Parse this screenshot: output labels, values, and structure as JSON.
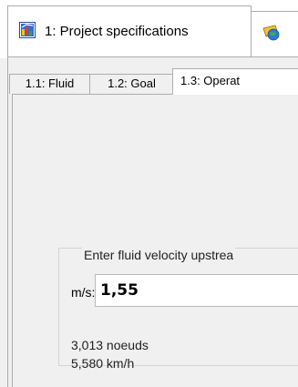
{
  "outer_tabs": [
    {
      "label": "1: Project specifications",
      "icon": "project-chart-icon",
      "active": true
    },
    {
      "label": "",
      "icon": "project-globe-icon",
      "active": false
    }
  ],
  "inner_tabs": [
    {
      "label": "1.1: Fluid"
    },
    {
      "label": "1.2: Goal"
    },
    {
      "label": "1.3: Operat",
      "active": true
    }
  ],
  "velocity": {
    "group_title": "Enter fluid velocity  upstrea",
    "unit": "m/s:",
    "value": "1,55",
    "conversions": [
      "3,013 noeuds",
      "5,580 km/h"
    ]
  }
}
